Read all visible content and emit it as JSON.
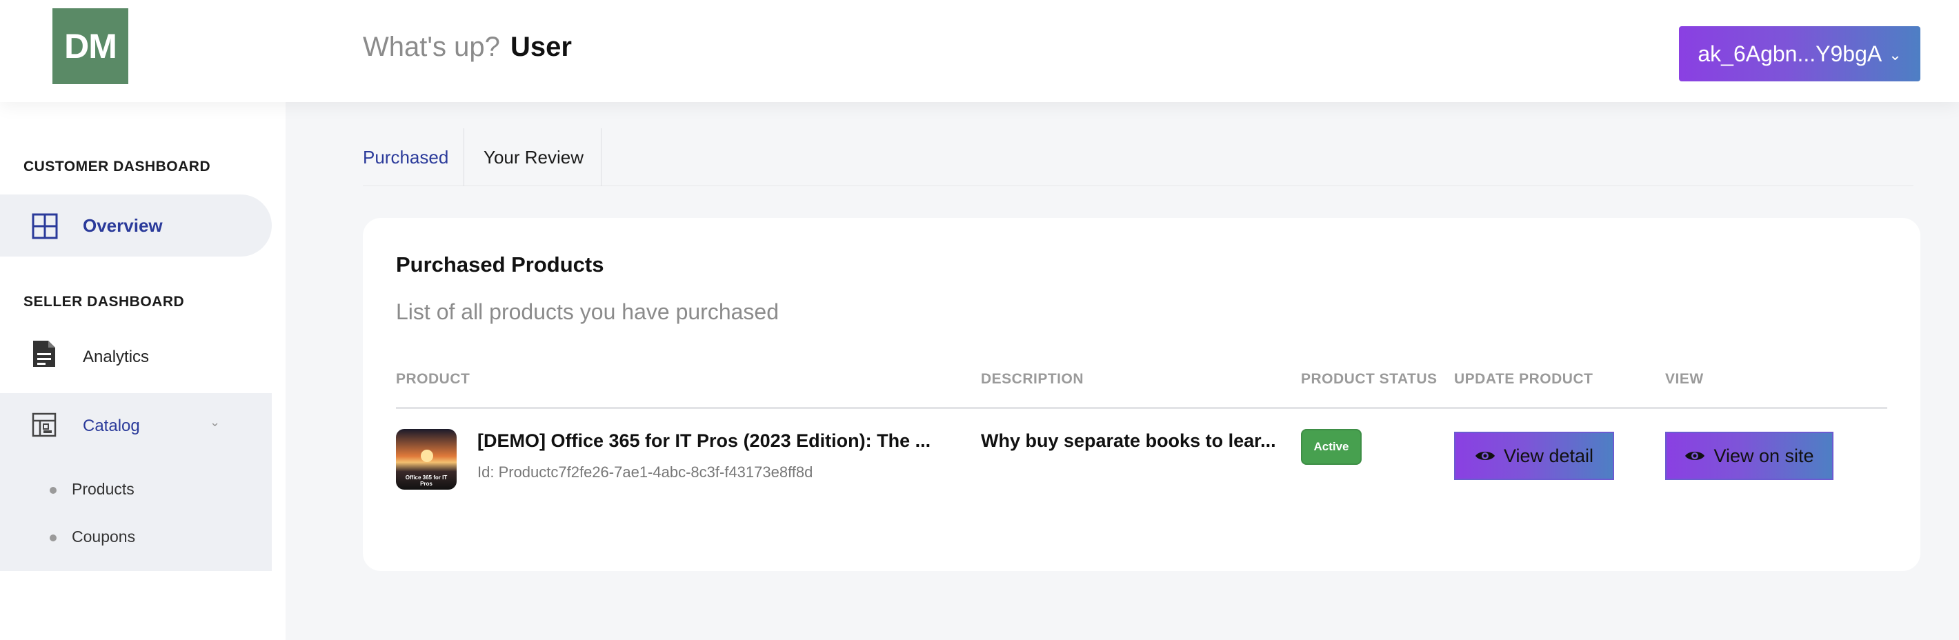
{
  "header": {
    "logo_text": "DM",
    "greeting_prefix": "What's up?",
    "greeting_user": "User",
    "account_label": "ak_6Agbn...Y9bgA"
  },
  "sidebar": {
    "customer_section": "CUSTOMER DASHBOARD",
    "overview_label": "Overview",
    "seller_section": "SELLER DASHBOARD",
    "analytics_label": "Analytics",
    "catalog_label": "Catalog",
    "catalog_items": [
      {
        "label": "Products"
      },
      {
        "label": "Coupons"
      }
    ]
  },
  "tabs": [
    {
      "label": "Purchased",
      "active": true
    },
    {
      "label": "Your Review",
      "active": false
    }
  ],
  "card": {
    "title": "Purchased Products",
    "subtitle": "List of all products you have purchased",
    "columns": [
      "PRODUCT",
      "DESCRIPTION",
      "PRODUCT STATUS",
      "UPDATE PRODUCT",
      "VIEW"
    ],
    "rows": [
      {
        "thumbnail_text": "Office 365 for IT Pros",
        "name": "[DEMO] Office 365 for IT Pros (2023 Edition): The ...",
        "id": "Id: Productc7f2fe26-7ae1-4abc-8c3f-f43173e8ff8d",
        "description": "Why buy separate books to lear...",
        "status": "Active",
        "update_label": "View detail",
        "view_label": "View on site"
      }
    ]
  },
  "colors": {
    "accent_blue": "#2a3a9a",
    "gradient_start": "#8a40e2",
    "gradient_end": "#4e7fc4",
    "status_green": "#47a04f",
    "logo_green": "#5a8a66"
  },
  "icons": {
    "overview": "grid-icon",
    "analytics": "document-icon",
    "catalog": "catalog-icon",
    "view": "eye-icon",
    "dropdown": "chevron-down-icon"
  }
}
